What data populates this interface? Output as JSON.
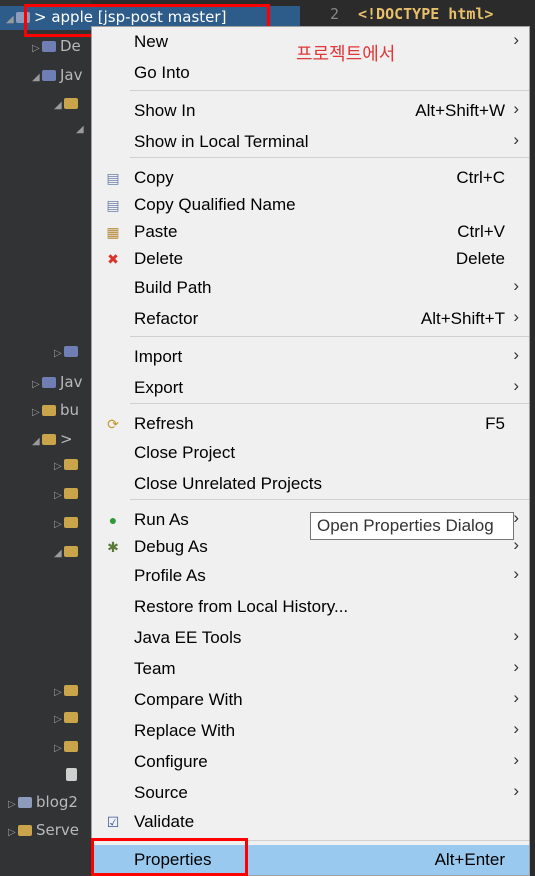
{
  "explorer": {
    "selected_project": "> apple [jsp-post master]",
    "rows": [
      {
        "label": "De"
      },
      {
        "label": "Jav"
      },
      {
        "label": ""
      },
      {
        "label": ""
      },
      {
        "label": "Jav"
      },
      {
        "label": "bu"
      },
      {
        "label": ">"
      },
      {
        "label": "blog2"
      },
      {
        "label": "Serve"
      }
    ]
  },
  "editor": {
    "line_number": "2",
    "code": "<!DOCTYPE html>"
  },
  "annotation": "프로젝트에서",
  "tooltip": "Open Properties Dialog",
  "menu": {
    "items": [
      {
        "label": "New",
        "shortcut": "",
        "submenu": true
      },
      {
        "label": "Go Into",
        "shortcut": "",
        "submenu": false
      },
      {
        "label": "Show In",
        "shortcut": "Alt+Shift+W",
        "submenu": true
      },
      {
        "label": "Show in Local Terminal",
        "shortcut": "",
        "submenu": true
      },
      {
        "label": "Copy",
        "shortcut": "Ctrl+C",
        "submenu": false
      },
      {
        "label": "Copy Qualified Name",
        "shortcut": "",
        "submenu": false
      },
      {
        "label": "Paste",
        "shortcut": "Ctrl+V",
        "submenu": false
      },
      {
        "label": "Delete",
        "shortcut": "Delete",
        "submenu": false
      },
      {
        "label": "Build Path",
        "shortcut": "",
        "submenu": true
      },
      {
        "label": "Refactor",
        "shortcut": "Alt+Shift+T",
        "submenu": true
      },
      {
        "label": "Import",
        "shortcut": "",
        "submenu": true
      },
      {
        "label": "Export",
        "shortcut": "",
        "submenu": true
      },
      {
        "label": "Refresh",
        "shortcut": "F5",
        "submenu": false
      },
      {
        "label": "Close Project",
        "shortcut": "",
        "submenu": false
      },
      {
        "label": "Close Unrelated Projects",
        "shortcut": "",
        "submenu": false
      },
      {
        "label": "Run As",
        "shortcut": "",
        "submenu": true
      },
      {
        "label": "Debug As",
        "shortcut": "",
        "submenu": true
      },
      {
        "label": "Profile As",
        "shortcut": "",
        "submenu": true
      },
      {
        "label": "Restore from Local History...",
        "shortcut": "",
        "submenu": false
      },
      {
        "label": "Java EE Tools",
        "shortcut": "",
        "submenu": true
      },
      {
        "label": "Team",
        "shortcut": "",
        "submenu": true
      },
      {
        "label": "Compare With",
        "shortcut": "",
        "submenu": true
      },
      {
        "label": "Replace With",
        "shortcut": "",
        "submenu": true
      },
      {
        "label": "Configure",
        "shortcut": "",
        "submenu": true
      },
      {
        "label": "Source",
        "shortcut": "",
        "submenu": true
      },
      {
        "label": "Validate",
        "shortcut": "",
        "submenu": false
      },
      {
        "label": "Properties",
        "shortcut": "Alt+Enter",
        "submenu": false,
        "selected": true
      }
    ],
    "submenu_glyph": "›"
  },
  "colors": {
    "menu_bg": "#f0f0f0",
    "selected_bg": "#99c9ef",
    "highlight_box": "#ff0000",
    "annotation": "#e0383a"
  }
}
